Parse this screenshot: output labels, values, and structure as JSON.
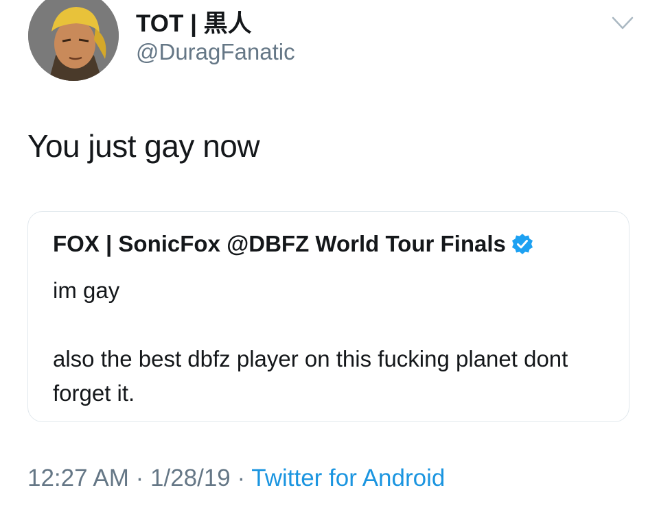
{
  "author": {
    "display_name": "TOT | 黒人",
    "handle": "@DuragFanatic",
    "avatar_icon": "avatar-durag-character"
  },
  "tweet": {
    "text": "You just gay now"
  },
  "quoted_tweet": {
    "author": "FOX | SonicFox @DBFZ World Tour Finals",
    "verified": true,
    "lines": [
      "im gay",
      "also the best dbfz player on this fucking planet dont forget it."
    ]
  },
  "meta": {
    "time": "12:27 AM",
    "separator": " · ",
    "date": "1/28/19",
    "source": "Twitter for Android"
  },
  "colors": {
    "text": "#14171a",
    "secondary": "#657786",
    "link": "#1b95e0",
    "verified": "#1da1f2",
    "border": "#e1e8ed"
  }
}
